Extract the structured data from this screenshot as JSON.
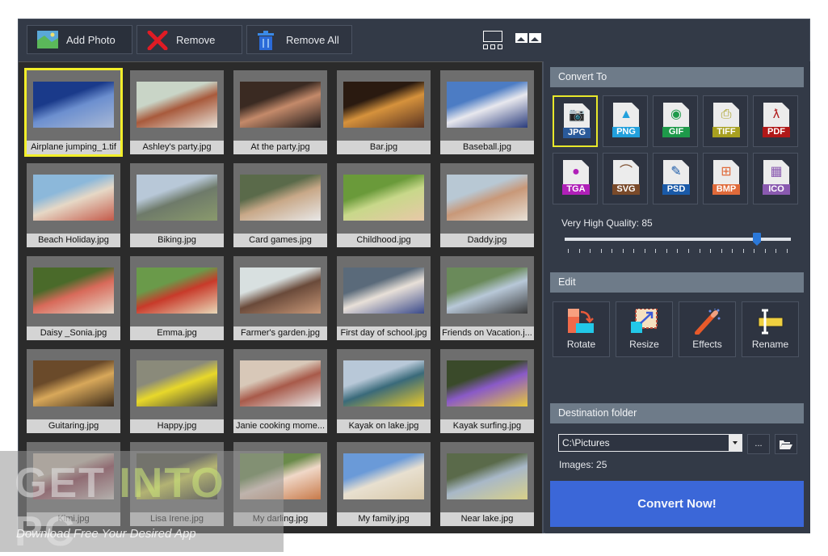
{
  "toolbar": {
    "add_photo": "Add Photo",
    "remove": "Remove",
    "remove_all": "Remove All",
    "view_modes": [
      "thumbnail-strip-view",
      "tile-view"
    ]
  },
  "gallery": {
    "selected_index": 0,
    "items": [
      {
        "name": "Airplane jumping_1.tif",
        "colors": [
          "#1a3a8a",
          "#6c8fcf",
          "#a9b9d6"
        ]
      },
      {
        "name": "Ashley's party.jpg",
        "colors": [
          "#c9d5c7",
          "#a85a3c",
          "#e8e2d8"
        ]
      },
      {
        "name": "At the party.jpg",
        "colors": [
          "#3a2a22",
          "#c48a6a",
          "#1f1a1a"
        ]
      },
      {
        "name": "Bar.jpg",
        "colors": [
          "#2a1a10",
          "#d6923c",
          "#5a3422"
        ]
      },
      {
        "name": "Baseball.jpg",
        "colors": [
          "#4c7cc4",
          "#e8e8ee",
          "#2a3c7c"
        ]
      },
      {
        "name": "Beach Holiday.jpg",
        "colors": [
          "#8cb8da",
          "#e6d8c6",
          "#c45a4a"
        ]
      },
      {
        "name": "Biking.jpg",
        "colors": [
          "#b8c8d8",
          "#6e7a6a",
          "#8a9a6c"
        ]
      },
      {
        "name": "Card games.jpg",
        "colors": [
          "#5a6a4a",
          "#c8a888",
          "#e8e8e8"
        ]
      },
      {
        "name": "Childhood.jpg",
        "colors": [
          "#6a9a3a",
          "#c8d88a",
          "#e8c8a8"
        ]
      },
      {
        "name": "Daddy.jpg",
        "colors": [
          "#b8c8d4",
          "#c89878",
          "#e8e2d8"
        ]
      },
      {
        "name": "Daisy _Sonia.jpg",
        "colors": [
          "#4a6a2a",
          "#d86a5a",
          "#e8d8c8"
        ]
      },
      {
        "name": "Emma.jpg",
        "colors": [
          "#6a9a4a",
          "#c83a2a",
          "#e8d8b8"
        ]
      },
      {
        "name": "Farmer's garden.jpg",
        "colors": [
          "#d8e0e0",
          "#6a4a3a",
          "#c89878"
        ]
      },
      {
        "name": "First day of school.jpg",
        "colors": [
          "#5a6a7a",
          "#e8e0d8",
          "#3a4a8a"
        ]
      },
      {
        "name": "Friends on Vacation.j...",
        "colors": [
          "#6a8a5a",
          "#b8c8d8",
          "#3a3a3a"
        ]
      },
      {
        "name": "Guitaring.jpg",
        "colors": [
          "#6a4a2a",
          "#d8a85a",
          "#3a2a1a"
        ]
      },
      {
        "name": "Happy.jpg",
        "colors": [
          "#8a8a7a",
          "#e8d82a",
          "#3a3a3a"
        ]
      },
      {
        "name": "Janie cooking mome...",
        "colors": [
          "#d8c8b8",
          "#a85a4a",
          "#e8e8e8"
        ]
      },
      {
        "name": "Kayak on lake.jpg",
        "colors": [
          "#b8c8d8",
          "#3a6a7a",
          "#e8c82a"
        ]
      },
      {
        "name": "Kayak surfing.jpg",
        "colors": [
          "#3a4a2a",
          "#8a5ac8",
          "#e8c83a"
        ]
      },
      {
        "name": "Kimi.jpg",
        "colors": [
          "#c8b8a8",
          "#8a3a4a",
          "#d8d0c8"
        ]
      },
      {
        "name": "Lisa Irene.jpg",
        "colors": [
          "#4a4a3a",
          "#d8d84a",
          "#2a2a2a"
        ]
      },
      {
        "name": "My darling.jpg",
        "colors": [
          "#6a8a4a",
          "#f0d8c8",
          "#c87a4a"
        ]
      },
      {
        "name": "My family.jpg",
        "colors": [
          "#6a9ad8",
          "#e8e0d0",
          "#d8c8a8"
        ]
      },
      {
        "name": "Near lake.jpg",
        "colors": [
          "#5a6a4a",
          "#a8b8c8",
          "#d8d088"
        ]
      }
    ]
  },
  "convert_to": {
    "title": "Convert To",
    "selected": "JPG",
    "formats": [
      {
        "label": "JPG",
        "band": "#2a5a9a",
        "icon": "camera-icon",
        "glyph": "📷"
      },
      {
        "label": "PNG",
        "band": "#22a0dc",
        "icon": "landscape-icon",
        "glyph": "▲"
      },
      {
        "label": "GIF",
        "band": "#1e9a4a",
        "icon": "color-wheel-icon",
        "glyph": "◉"
      },
      {
        "label": "TIFF",
        "band": "#a8a020",
        "icon": "printer-icon",
        "glyph": "⎙"
      },
      {
        "label": "PDF",
        "band": "#b01818",
        "icon": "acrobat-icon",
        "glyph": "ƛ"
      },
      {
        "label": "TGA",
        "band": "#b020b8",
        "icon": "rgb-circles-icon",
        "glyph": "●"
      },
      {
        "label": "SVG",
        "band": "#7a4a2a",
        "icon": "bezier-icon",
        "glyph": "⌒"
      },
      {
        "label": "PSD",
        "band": "#1a5aa8",
        "icon": "brush-icon",
        "glyph": "✎"
      },
      {
        "label": "BMP",
        "band": "#e06a3a",
        "icon": "windows-icon",
        "glyph": "⊞"
      },
      {
        "label": "ICO",
        "band": "#8a5ab0",
        "icon": "grid-icon",
        "glyph": "▦"
      }
    ],
    "quality_label": "Very High Quality: 85",
    "quality_value": 85,
    "quality_min": 0,
    "quality_max": 100
  },
  "edit": {
    "title": "Edit",
    "buttons": [
      {
        "label": "Rotate",
        "icon": "rotate-icon"
      },
      {
        "label": "Resize",
        "icon": "resize-icon"
      },
      {
        "label": "Effects",
        "icon": "magic-wand-icon"
      },
      {
        "label": "Rename",
        "icon": "rename-icon"
      }
    ]
  },
  "destination": {
    "title": "Destination folder",
    "path": "C:\\Pictures",
    "browse_label": "...",
    "images_label": "Images: 25"
  },
  "convert_now": "Convert Now!",
  "watermark": {
    "brand": "GET INTO PC",
    "tagline": "Download Free Your Desired App"
  }
}
